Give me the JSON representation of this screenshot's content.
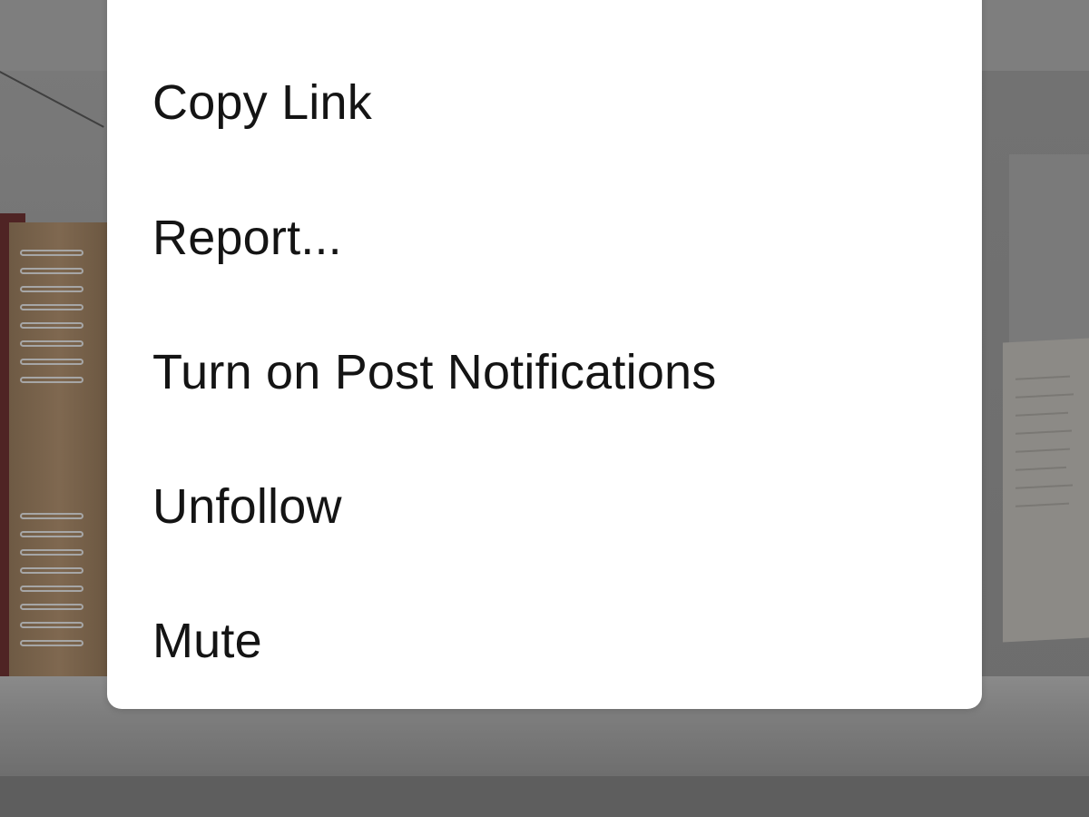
{
  "menu": {
    "items": [
      {
        "label": "Copy Link"
      },
      {
        "label": "Report..."
      },
      {
        "label": "Turn on Post Notifications"
      },
      {
        "label": "Unfollow"
      },
      {
        "label": "Mute"
      }
    ]
  },
  "colors": {
    "menu_background": "#ffffff",
    "text": "#141414",
    "overlay_dim": "#6f6f6f"
  }
}
